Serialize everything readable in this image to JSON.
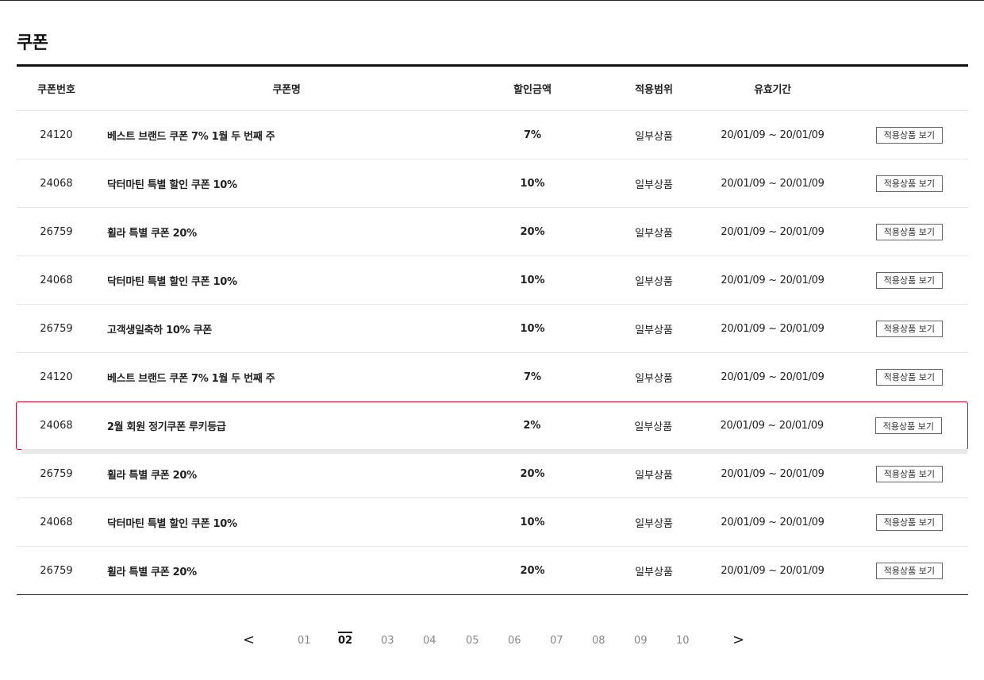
{
  "page": {
    "title": "쿠폰"
  },
  "table": {
    "headers": {
      "no": "쿠폰번호",
      "name": "쿠폰명",
      "amount": "할인금액",
      "scope": "적용범위",
      "period": "유효기간"
    },
    "rows": [
      {
        "no": "24120",
        "name": "베스트 브랜드 쿠폰 7% 1월 두 번째 주",
        "amount": "7%",
        "scope": "일부상품",
        "period": "20/01/09 ~ 20/01/09",
        "action": "적용상품 보기"
      },
      {
        "no": "24068",
        "name": "닥터마틴 특별 할인 쿠폰 10%",
        "amount": "10%",
        "scope": "일부상품",
        "period": "20/01/09 ~ 20/01/09",
        "action": "적용상품 보기"
      },
      {
        "no": "26759",
        "name": "휠라 특별 쿠폰 20%",
        "amount": "20%",
        "scope": "일부상품",
        "period": "20/01/09 ~ 20/01/09",
        "action": "적용상품 보기"
      },
      {
        "no": "24068",
        "name": "닥터마틴 특별 할인 쿠폰 10%",
        "amount": "10%",
        "scope": "일부상품",
        "period": "20/01/09 ~ 20/01/09",
        "action": "적용상품 보기"
      },
      {
        "no": "26759",
        "name": "고객생일축하 10% 쿠폰",
        "amount": "10%",
        "scope": "일부상품",
        "period": "20/01/09 ~ 20/01/09",
        "action": "적용상품 보기"
      },
      {
        "no": "24120",
        "name": "베스트 브랜드 쿠폰 7% 1월 두 번째 주",
        "amount": "7%",
        "scope": "일부상품",
        "period": "20/01/09 ~ 20/01/09",
        "action": "적용상품 보기"
      },
      {
        "no": "24068",
        "name": "2월 회원 정기쿠폰 루키등급",
        "amount": "2%",
        "scope": "일부상품",
        "period": "20/01/09 ~ 20/01/09",
        "action": "적용상품 보기"
      },
      {
        "no": "26759",
        "name": "휠라 특별 쿠폰 20%",
        "amount": "20%",
        "scope": "일부상품",
        "period": "20/01/09 ~ 20/01/09",
        "action": "적용상품 보기"
      },
      {
        "no": "24068",
        "name": "닥터마틴 특별 할인 쿠폰 10%",
        "amount": "10%",
        "scope": "일부상품",
        "period": "20/01/09 ~ 20/01/09",
        "action": "적용상품 보기"
      },
      {
        "no": "26759",
        "name": "휠라 특별 쿠폰 20%",
        "amount": "20%",
        "scope": "일부상품",
        "period": "20/01/09 ~ 20/01/09",
        "action": "적용상품 보기"
      }
    ]
  },
  "pagination": {
    "prev": "<",
    "next": ">",
    "pages": [
      "01",
      "02",
      "03",
      "04",
      "05",
      "06",
      "07",
      "08",
      "09",
      "10"
    ],
    "current": "02"
  },
  "colors": {
    "highlight_border": "#c8102e",
    "text": "#111111",
    "inactive_page": "#888888"
  }
}
